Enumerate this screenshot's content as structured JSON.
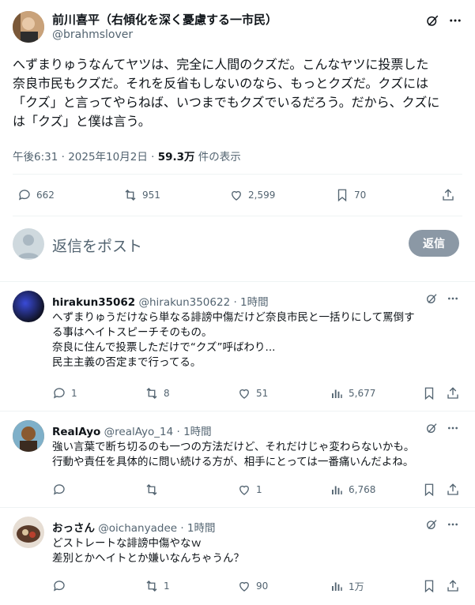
{
  "main_post": {
    "author_name": "前川喜平（右傾化を深く憂慮する一市民）",
    "author_handle": "@brahmslover",
    "lines": [
      "へずまりゅうなんてヤツは、完全に人間のクズだ。こんなヤツに投票した",
      "奈良市民もクズだ。それを反省もしないのなら、もっとクズだ。クズには",
      "「クズ」と言ってやらねば、いつまでもクズでいるだろう。だから、クズに",
      "は「クズ」と僕は言う。"
    ],
    "meta_time": "午後6:31 · 2025年10月2日 · ",
    "meta_views": "59.3万",
    "meta_views_suffix": " 件の表示",
    "replies": "662",
    "reposts": "951",
    "likes": "2,599",
    "bookmarks": "70"
  },
  "composer": {
    "placeholder": "返信をポスト",
    "button": "返信"
  },
  "replies": [
    {
      "name": "hirakun35062",
      "handle": "@hirakun350622 · 1時間",
      "lines": [
        "へずまりゅうだけなら単なる誹謗中傷だけど奈良市民と一括りにして罵倒す",
        "る事はヘイトスピーチそのもの。",
        "奈良に住んで投票しただけで“クズ”呼ばわり...",
        "民主主義の否定まで行ってる。"
      ],
      "replies": "1",
      "reposts": "8",
      "likes": "51",
      "views": "5,677"
    },
    {
      "name": "RealAyo",
      "handle": "@realAyo_14 · 1時間",
      "lines": [
        "強い言葉で断ち切るのも一つの方法だけど、それだけじゃ変わらないかも。",
        "行動や責任を具体的に問い続ける方が、相手にとっては一番痛いんだよね。"
      ],
      "replies": "",
      "reposts": "",
      "likes": "1",
      "views": "6,768"
    },
    {
      "name": "おっさん",
      "handle": "@oichanyadee · 1時間",
      "lines": [
        "どストレートな誹謗中傷やなｗ",
        "差別とかヘイトとか嫌いなんちゃうん？"
      ],
      "replies": "",
      "reposts": "1",
      "likes": "90",
      "views": "1万"
    }
  ]
}
